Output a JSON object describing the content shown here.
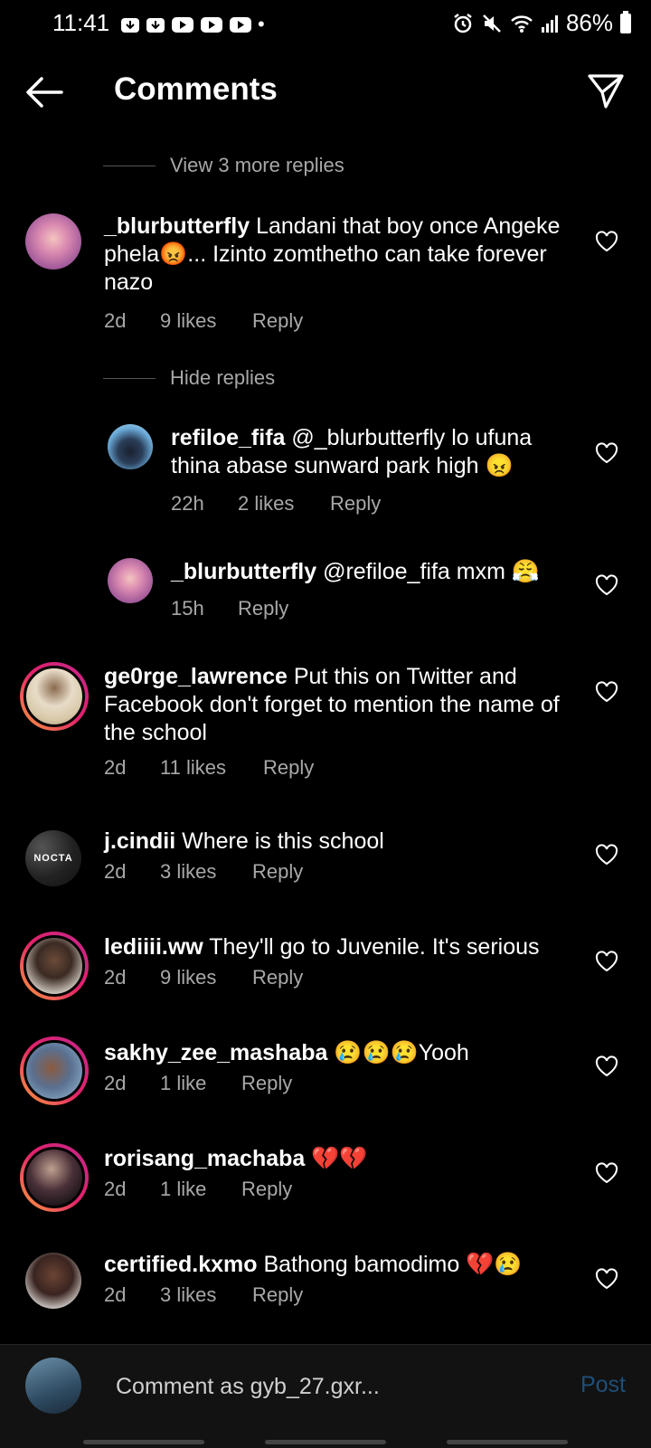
{
  "status_bar": {
    "time": "11:41",
    "battery": "86%",
    "dot": "•"
  },
  "header": {
    "title": "Comments"
  },
  "toggles": {
    "view_more": "View 3 more replies",
    "hide": "Hide replies"
  },
  "comments": [
    {
      "user": "_blurbutterfly",
      "text": " Landani that boy once Angeke phela😡... Izinto zomthetho can take forever nazo",
      "time": "2d",
      "likes": "9 likes",
      "reply": "Reply"
    },
    {
      "user": "refiloe_fifa",
      "text": " @_blurbutterfly lo ufuna thina abase sunward park high 😠",
      "time": "22h",
      "likes": "2 likes",
      "reply": "Reply"
    },
    {
      "user": "_blurbutterfly",
      "text": " @refiloe_fifa mxm 😤",
      "time": "15h",
      "likes": "",
      "reply": "Reply"
    },
    {
      "user": "ge0rge_lawrence",
      "text": " Put this on Twitter and Facebook don't forget to mention the name of the school",
      "time": "2d",
      "likes": "11 likes",
      "reply": "Reply"
    },
    {
      "user": "j.cindii",
      "text": " Where is this school",
      "time": "2d",
      "likes": "3 likes",
      "reply": "Reply",
      "avatar_label": "NOCTA"
    },
    {
      "user": "lediiii.ww",
      "text": " They'll go to Juvenile. It's serious",
      "time": "2d",
      "likes": "9 likes",
      "reply": "Reply"
    },
    {
      "user": "sakhy_zee_mashaba",
      "text": " 😢😢😢Yooh",
      "time": "2d",
      "likes": "1 like",
      "reply": "Reply"
    },
    {
      "user": "rorisang_machaba",
      "text": " 💔💔",
      "time": "2d",
      "likes": "1 like",
      "reply": "Reply"
    },
    {
      "user": "certified.kxmo",
      "text": " Bathong bamodimo 💔😢",
      "time": "2d",
      "likes": "3 likes",
      "reply": "Reply"
    }
  ],
  "composer": {
    "placeholder": "Comment as gyb_27.gxr...",
    "post_label": "Post"
  },
  "colors": {
    "ring_gradient": [
      "#f9a13c",
      "#e2226a",
      "#c3278c"
    ],
    "post_disabled": "#1e4f78",
    "meta_gray": "#a8a8a8"
  }
}
